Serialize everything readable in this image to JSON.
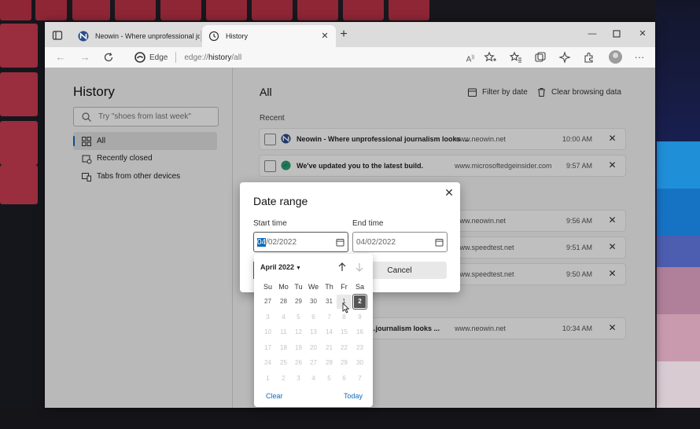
{
  "window": {
    "tabs": [
      {
        "title": "Neowin - Where unprofessional journalism looks better",
        "active": false
      },
      {
        "title": "History",
        "active": true
      }
    ]
  },
  "toolbar": {
    "brand": "Edge",
    "url_scheme": "edge://",
    "url_host": "history",
    "url_path": "/all"
  },
  "sidebar": {
    "title": "History",
    "search_placeholder": "Try \"shoes from last week\"",
    "items": [
      {
        "label": "All",
        "selected": true
      },
      {
        "label": "Recently closed",
        "selected": false
      },
      {
        "label": "Tabs from other devices",
        "selected": false
      }
    ]
  },
  "main": {
    "title": "All",
    "filter_label": "Filter by date",
    "clear_label": "Clear browsing data",
    "section_recent": "Recent",
    "rows": [
      {
        "title": "Neowin - Where unprofessional journalism looks ...",
        "domain": "www.neowin.net",
        "time": "10:00 AM"
      },
      {
        "title": "We've updated you to the latest build.",
        "domain": "www.microsoftedgeinsider.com",
        "time": "9:57 AM"
      },
      {
        "title": "",
        "domain": "www.neowin.net",
        "time": "9:56 AM"
      },
      {
        "title": "",
        "domain": "www.speedtest.net",
        "time": "9:51 AM"
      },
      {
        "title": "",
        "domain": "www.speedtest.net",
        "time": "9:50 AM"
      },
      {
        "title": "...journalism looks ...",
        "domain": "www.neowin.net",
        "time": "10:34 AM"
      }
    ]
  },
  "dialog": {
    "title": "Date range",
    "start_label": "Start time",
    "end_label": "End time",
    "start_month": "04",
    "start_rest": "/02/2022",
    "end_value": "04/02/2022",
    "cancel_label": "Cancel"
  },
  "calendar": {
    "month_label": "April 2022",
    "weekdays": [
      "Su",
      "Mo",
      "Tu",
      "We",
      "Th",
      "Fr",
      "Sa"
    ],
    "weeks": [
      [
        "27",
        "28",
        "29",
        "30",
        "31",
        "1",
        "2"
      ],
      [
        "3",
        "4",
        "5",
        "6",
        "7",
        "8",
        "9"
      ],
      [
        "10",
        "11",
        "12",
        "13",
        "14",
        "15",
        "16"
      ],
      [
        "17",
        "18",
        "19",
        "20",
        "21",
        "22",
        "23"
      ],
      [
        "24",
        "25",
        "26",
        "27",
        "28",
        "29",
        "30"
      ],
      [
        "1",
        "2",
        "3",
        "4",
        "5",
        "6",
        "7"
      ]
    ],
    "selected_day": "2",
    "clear_label": "Clear",
    "today_label": "Today"
  },
  "colors": {
    "accent": "#0f6cbd",
    "selected_day_bg": "#555555"
  }
}
